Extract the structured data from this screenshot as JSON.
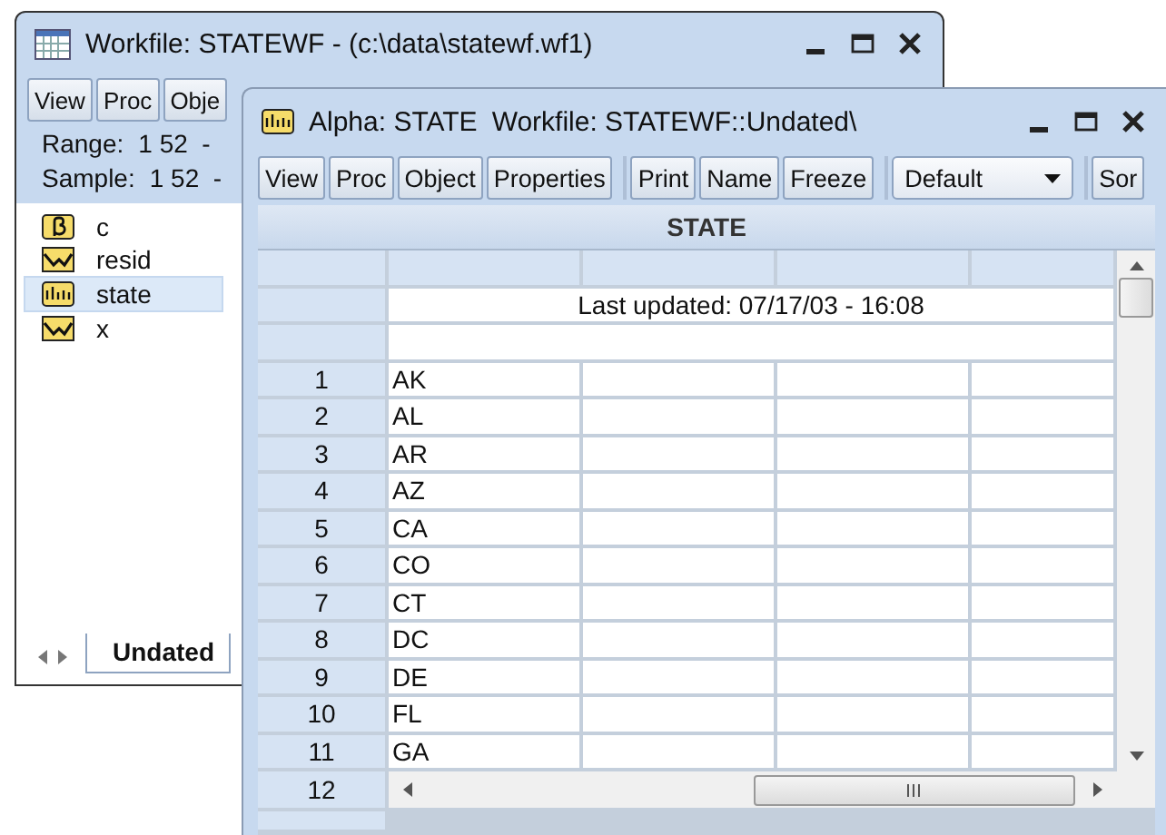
{
  "workfile_window": {
    "title": "Workfile: STATEWF - (c:\\data\\statewf.wf1)",
    "toolbar": [
      "View",
      "Proc",
      "Obje"
    ],
    "range": {
      "label": "Range:",
      "value": "1 52  -"
    },
    "sample": {
      "label": "Sample:",
      "value": "1 52  -"
    },
    "objects": [
      {
        "name": "c",
        "kind": "coef",
        "selected": false
      },
      {
        "name": "resid",
        "kind": "series",
        "selected": false
      },
      {
        "name": "state",
        "kind": "alpha",
        "selected": true
      },
      {
        "name": "x",
        "kind": "series",
        "selected": false
      }
    ],
    "tabs": [
      {
        "label": "Undated",
        "selected": true
      }
    ]
  },
  "alpha_window": {
    "title": "Alpha: STATE",
    "subtitle": "Workfile: STATEWF::Undated\\",
    "toolbar_groups": [
      [
        {
          "kind": "button",
          "label": "View"
        },
        {
          "kind": "button",
          "label": "Proc"
        },
        {
          "kind": "button",
          "label": "Object"
        },
        {
          "kind": "button",
          "label": "Properties"
        }
      ],
      [
        {
          "kind": "button",
          "label": "Print"
        },
        {
          "kind": "button",
          "label": "Name"
        },
        {
          "kind": "button",
          "label": "Freeze"
        }
      ],
      [
        {
          "kind": "dropdown",
          "label": "Default"
        }
      ],
      [
        {
          "kind": "button",
          "label": "Sor"
        }
      ]
    ],
    "column_header": "STATE",
    "note": "Last updated: 07/17/03 - 16:08",
    "rows": [
      {
        "label": "1",
        "value": "AK"
      },
      {
        "label": "2",
        "value": "AL"
      },
      {
        "label": "3",
        "value": "AR"
      },
      {
        "label": "4",
        "value": "AZ"
      },
      {
        "label": "5",
        "value": "CA"
      },
      {
        "label": "6",
        "value": "CO"
      },
      {
        "label": "7",
        "value": "CT"
      },
      {
        "label": "8",
        "value": "DC"
      },
      {
        "label": "9",
        "value": "DE"
      },
      {
        "label": "10",
        "value": "FL"
      },
      {
        "label": "11",
        "value": "GA"
      },
      {
        "label": "12"
      }
    ]
  }
}
